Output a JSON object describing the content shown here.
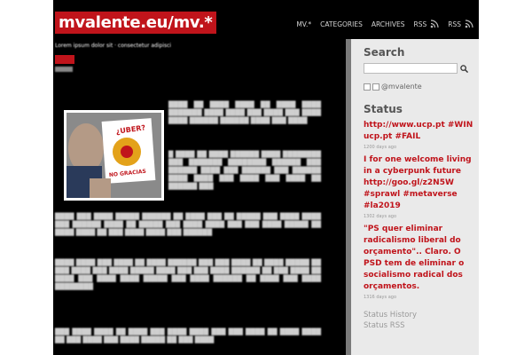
{
  "site": {
    "title": "mvalente.eu/mv.*"
  },
  "nav": {
    "items": [
      {
        "label": "MV.*"
      },
      {
        "label": "CATEGORIES"
      },
      {
        "label": "ARCHIVES"
      },
      {
        "label": "RSS",
        "icon": "rss-icon"
      },
      {
        "label": "RSS",
        "icon": "rss-icon"
      }
    ]
  },
  "post": {
    "meta": "Lorem ipsum dolor sit · consectetur adipisci",
    "photo_sign_line1": "¿UBER?",
    "photo_sign_line2": "NO GRACIAS"
  },
  "sidebar": {
    "search_heading": "Search",
    "search_placeholder": "",
    "user_label": "@mvalente",
    "status_heading": "Status",
    "statuses": [
      {
        "text": "http://www.ucp.pt #WIN ucp.pt #FAIL",
        "time": "1200 days ago"
      },
      {
        "text": "I for one welcome living in a cyberpunk future http://goo.gl/z2N5W #sprawl #metaverse #la2019",
        "time": "1302 days ago"
      },
      {
        "text": "\"PS quer eliminar radicalismo liberal do orçamento\".. Claro. O PSD tem de eliminar o socialismo radical dos orçamentos.",
        "time": "1316 days ago"
      }
    ],
    "history_link": "Status History",
    "rss_link": "Status RSS"
  },
  "colors": {
    "accent": "#c0141b",
    "background": "#000000",
    "sidebar": "#eaeaea"
  }
}
